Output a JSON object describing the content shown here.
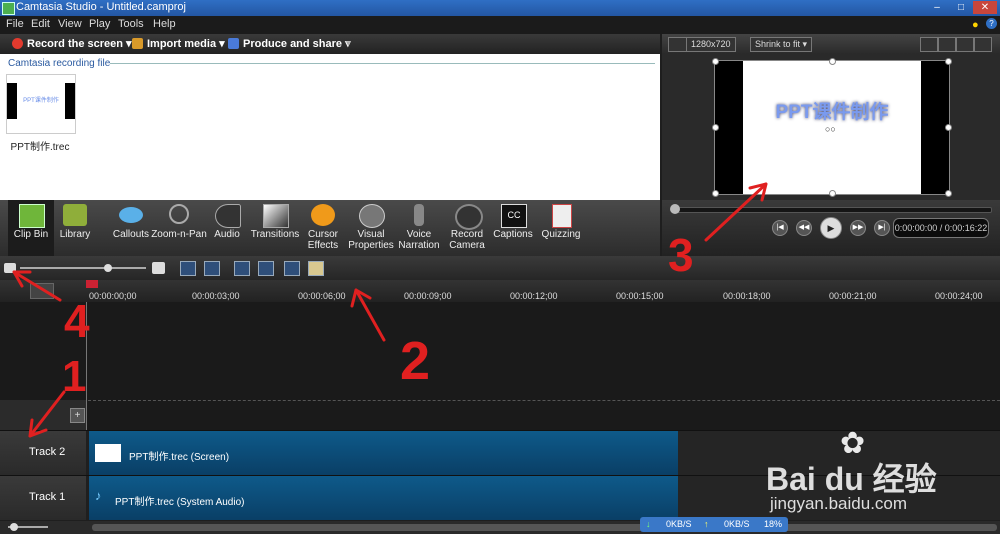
{
  "window": {
    "title": "Camtasia Studio - Untitled.camproj"
  },
  "menu": [
    "File",
    "Edit",
    "View",
    "Play",
    "Tools",
    "Help"
  ],
  "tasks": {
    "record": "Record the screen",
    "import": "Import media",
    "produce": "Produce and share"
  },
  "clipbin": {
    "header": "Camtasia recording file",
    "clip_name": "PPT制作.trec",
    "thumb_text": "PPT课件制作"
  },
  "tools": [
    {
      "label": "Clip Bin"
    },
    {
      "label": "Library"
    },
    {
      "label": "Callouts"
    },
    {
      "label": "Zoom-n-Pan"
    },
    {
      "label": "Audio"
    },
    {
      "label": "Transitions"
    },
    {
      "label": "Cursor Effects"
    },
    {
      "label": "Visual Properties"
    },
    {
      "label": "Voice Narration"
    },
    {
      "label": "Record Camera"
    },
    {
      "label": "Captions"
    },
    {
      "label": "Quizzing"
    }
  ],
  "preview": {
    "resolution": "1280x720",
    "zoom": "Shrink to fit",
    "canvas_text": "PPT课件制作",
    "timecode": "0:00:00:00 / 0:00:16:22"
  },
  "ruler": {
    "ticks": [
      "00:00:00;00",
      "00:00:03;00",
      "00:00:06;00",
      "00:00:09;00",
      "00:00:12;00",
      "00:00:15;00",
      "00:00:18;00",
      "00:00:21;00",
      "00:00:24;00"
    ]
  },
  "tracks": [
    {
      "name": "Track 2",
      "clip": "PPT制作.trec (Screen)"
    },
    {
      "name": "Track 1",
      "clip": "PPT制作.trec (System Audio)"
    }
  ],
  "status": {
    "down": "0KB/S",
    "up": "0KB/S",
    "percent": "18%"
  },
  "watermark": {
    "brand": "Bai du 经验",
    "url": "jingyan.baidu.com"
  },
  "annotations": [
    "1",
    "2",
    "3",
    "4"
  ],
  "colors": {
    "accent": "#2f6fc4",
    "clip": "#0e5a8a",
    "annotation": "#e02020"
  }
}
